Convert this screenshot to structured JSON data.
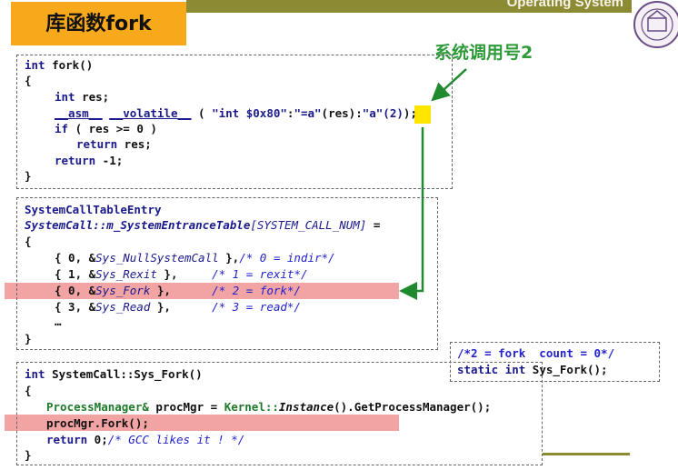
{
  "header": {
    "title": "库函数fork",
    "banner": "Operating System",
    "logo_icon": "university-seal-icon"
  },
  "callout": {
    "label": "系统调用号2",
    "color": "#2e9a3a"
  },
  "code1": {
    "l1_kw": "int",
    "l1_rest": " fork()",
    "l2": "{",
    "l3_kw": "int",
    "l3_rest": " res;",
    "l4_asm": "__asm__",
    "l4_sp": " ",
    "l4_vol": "__volatile__",
    "l4_open": " ( ",
    "l4_str1": "\"int $0x80\"",
    "l4_c1": ":",
    "l4_str2": "\"=a\"",
    "l4_res": "(res)",
    "l4_c2": ":",
    "l4_str3": "\"a\"",
    "l4_num": "(2)",
    "l4_close": ");",
    "l5_kw": "if",
    "l5_rest": " ( res >= 0 )",
    "l6_kw": "return",
    "l6_rest": " res;",
    "l7_kw": "return",
    "l7_rest": " -1;",
    "l8": "}"
  },
  "code2": {
    "l1": "SystemCallTableEntry",
    "l2_a": "SystemCall::m_SystemEntranceTable",
    "l2_b": "[SYSTEM_CALL_NUM]",
    "l2_c": " =",
    "l3": "{",
    "r1_a": "{ 0, &",
    "r1_b": "Sys_NullSystemCall",
    "r1_c": " },",
    "r1_d": "/* 0 = indir*/",
    "r2_a": "{ 1, &",
    "r2_b": "Sys_Rexit",
    "r2_c": " },     ",
    "r2_d": "/* 1 = rexit*/",
    "r3_a": "{ 0, &",
    "r3_b": "Sys_Fork",
    "r3_c": " },      ",
    "r3_d": "/* 2 = fork*/",
    "r4_a": "{ 3, &",
    "r4_b": "Sys_Read",
    "r4_c": " },      ",
    "r4_d": "/* 3 = read*/",
    "ellipsis": "…",
    "close": "}"
  },
  "code3": {
    "l1_kw": "int",
    "l1_rest": " SystemCall::Sys_Fork()",
    "l2": "{",
    "l3_a": "ProcessManager&",
    "l3_b": " procMgr = ",
    "l3_c": "Kernel::",
    "l3_d": "Instance",
    "l3_e": "().GetProcessManager();",
    "l4": "procMgr.Fork();",
    "l5_kw": "return",
    "l5_num": " 0;",
    "l5_cmt": "/* GCC likes it ! */",
    "l6": "}"
  },
  "code4": {
    "l1": "/*2 = fork  count = 0*/",
    "l2_kw1": "static",
    "l2_kw2": " int",
    "l2_rest": " Sys_Fork();"
  },
  "colors": {
    "title_bg": "#f7a81b",
    "banner_bg": "#8c8a32",
    "highlight_pink": "#f2a3a3",
    "highlight_yellow": "#ffe600",
    "arrow_green": "#1f8a2e"
  }
}
